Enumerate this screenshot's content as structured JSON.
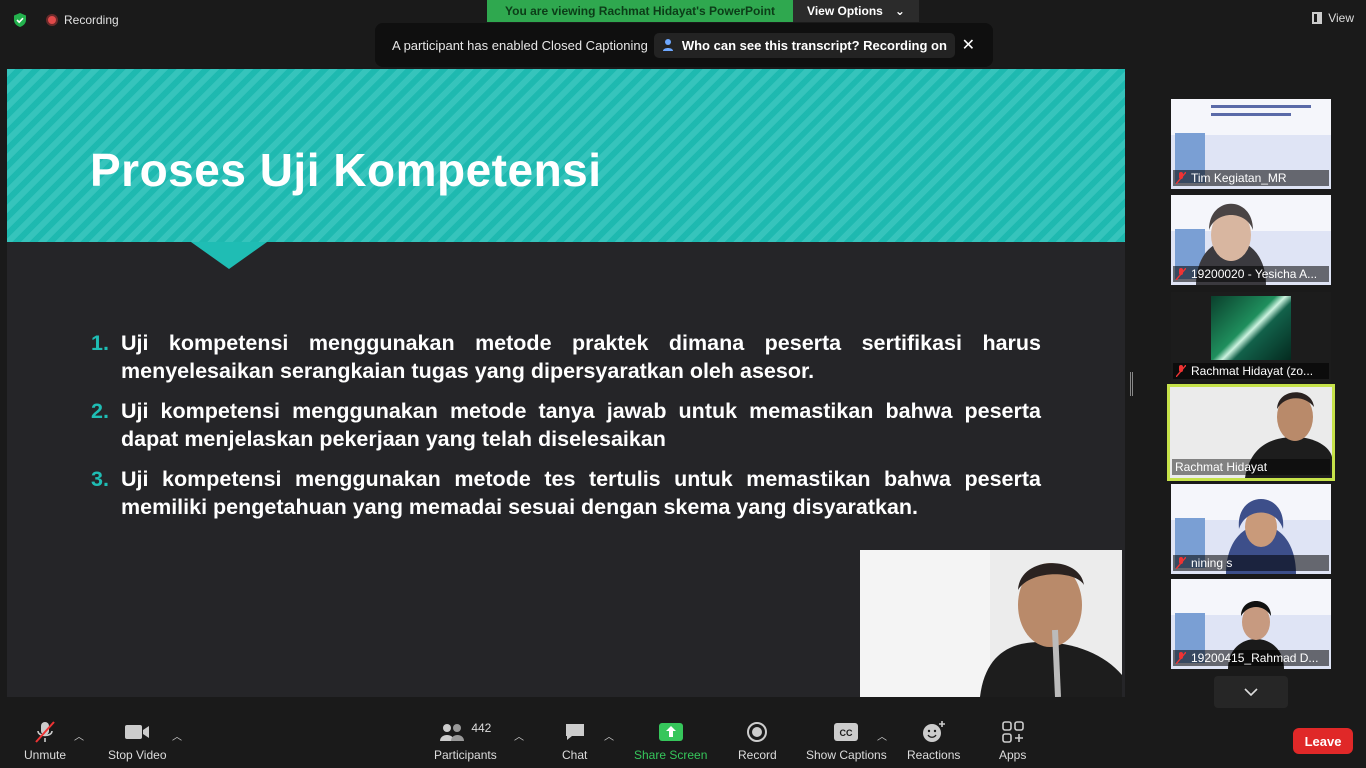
{
  "top": {
    "recording_label": "Recording",
    "viewing_label": "You are viewing Rachmat Hidayat's PowerPoint",
    "view_options_label": "View Options",
    "view_label": "View"
  },
  "cc_banner": {
    "message": "A participant has enabled Closed Captioning",
    "who_label": "Who can see this transcript? Recording on",
    "close_icon": "close-icon"
  },
  "slide": {
    "title": "Proses Uji Kompetensi",
    "items": [
      {
        "num": "1.",
        "text": "Uji kompetensi menggunakan metode praktek dimana peserta sertifikasi harus menyelesaikan serangkaian tugas yang dipersyaratkan oleh asesor."
      },
      {
        "num": "2.",
        "text": "Uji kompetensi menggunakan metode tanya jawab untuk memastikan bahwa peserta dapat menjelaskan pekerjaan yang telah diselesaikan"
      },
      {
        "num": "3.",
        "text": "Uji kompetensi menggunakan metode tes tertulis untuk memastikan bahwa peserta memiliki pengetahuan yang memadai sesuai dengan skema yang disyaratkan."
      }
    ],
    "accent_color": "#1fbdb4"
  },
  "gallery": [
    {
      "name": "Tim Kegiatan_MR"
    },
    {
      "name": "19200020 - Yesicha A..."
    },
    {
      "name": "Rachmat Hidayat (zo..."
    },
    {
      "name": "Rachmat Hidayat"
    },
    {
      "name": "nining s"
    },
    {
      "name": "19200415_Rahmad D..."
    }
  ],
  "toolbar": {
    "unmute": "Unmute",
    "stop_video": "Stop Video",
    "participants": "Participants",
    "participants_count": "442",
    "chat": "Chat",
    "share_screen": "Share Screen",
    "record": "Record",
    "show_captions": "Show Captions",
    "reactions": "Reactions",
    "apps": "Apps",
    "leave": "Leave"
  }
}
